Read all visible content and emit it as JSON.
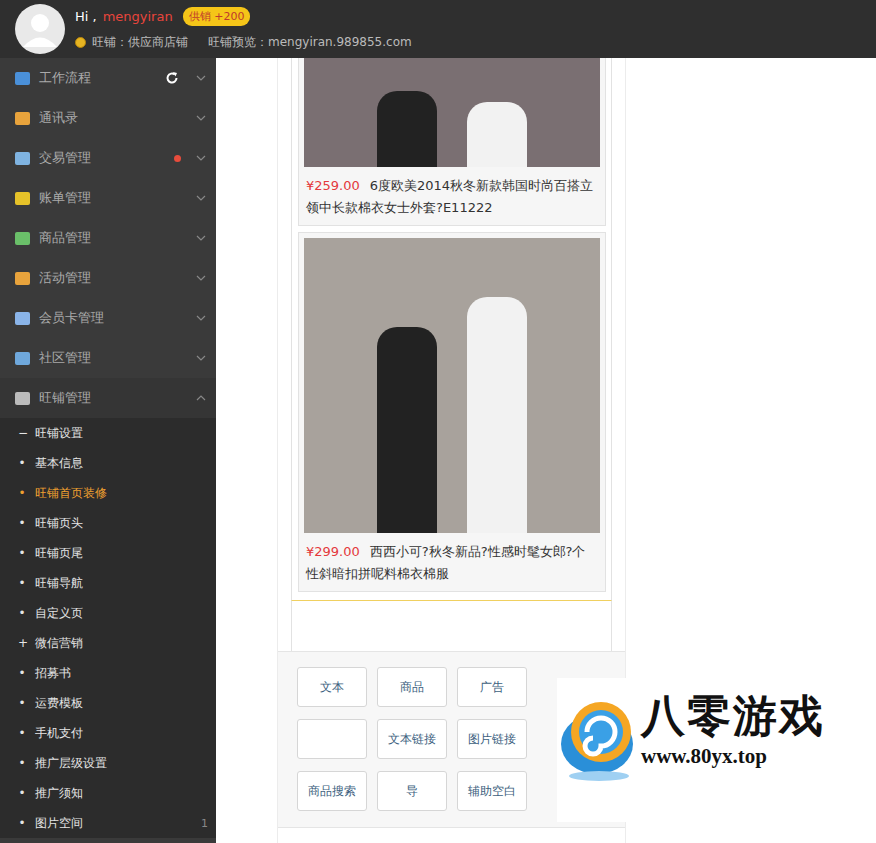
{
  "header": {
    "greeting": "Hi ,",
    "username": "mengyiran",
    "badge": "供销 +200",
    "shop": "旺铺：供应商店铺",
    "preview": "旺铺预览：mengyiran.989855.com"
  },
  "sidebar": {
    "menu": [
      {
        "label": "工作流程",
        "expanded": false,
        "refreshable": true,
        "alert": false
      },
      {
        "label": "通讯录",
        "expanded": false,
        "refreshable": false,
        "alert": false
      },
      {
        "label": "交易管理",
        "expanded": false,
        "refreshable": false,
        "alert": true
      },
      {
        "label": "账单管理",
        "expanded": false,
        "refreshable": false,
        "alert": false
      },
      {
        "label": "商品管理",
        "expanded": false,
        "refreshable": false,
        "alert": false
      },
      {
        "label": "活动管理",
        "expanded": false,
        "refreshable": false,
        "alert": false
      },
      {
        "label": "会员卡管理",
        "expanded": false,
        "refreshable": false,
        "alert": false
      },
      {
        "label": "社区管理",
        "expanded": false,
        "refreshable": false,
        "alert": false
      },
      {
        "label": "旺铺管理",
        "expanded": true,
        "refreshable": false,
        "alert": false
      }
    ],
    "submenu": [
      {
        "marker": "−",
        "label": "旺铺设置",
        "selected": false
      },
      {
        "marker": "•",
        "label": "基本信息",
        "selected": false
      },
      {
        "marker": "•",
        "label": "旺铺首页装修",
        "selected": true
      },
      {
        "marker": "•",
        "label": "旺铺页头",
        "selected": false
      },
      {
        "marker": "•",
        "label": "旺铺页尾",
        "selected": false
      },
      {
        "marker": "•",
        "label": "旺铺导航",
        "selected": false
      },
      {
        "marker": "•",
        "label": "自定义页",
        "selected": false
      },
      {
        "marker": "+",
        "label": "微信营销",
        "selected": false
      },
      {
        "marker": "•",
        "label": "招募书",
        "selected": false
      },
      {
        "marker": "•",
        "label": "运费模板",
        "selected": false
      },
      {
        "marker": "•",
        "label": "手机支付",
        "selected": false
      },
      {
        "marker": "•",
        "label": "推广层级设置",
        "selected": false
      },
      {
        "marker": "•",
        "label": "推广须知",
        "selected": false
      },
      {
        "marker": "•",
        "label": "图片空间",
        "selected": false,
        "count": "1"
      }
    ]
  },
  "products": [
    {
      "price": "¥259.00",
      "title": "6度欧美2014秋冬新款韩国时尚百搭立领中长款棉衣女士外套?E11222"
    },
    {
      "price": "¥299.00",
      "title": "西西小可?秋冬新品?性感时髦女郎?个性斜暗扣拼呢料棉衣棉服"
    }
  ],
  "tools": [
    "文本",
    "商品",
    "广告",
    "",
    "文本链接",
    "图片链接",
    "商品搜索",
    "导",
    "辅助空白"
  ],
  "watermark": {
    "title": "八零游戏",
    "url": "www.80yx.top"
  }
}
